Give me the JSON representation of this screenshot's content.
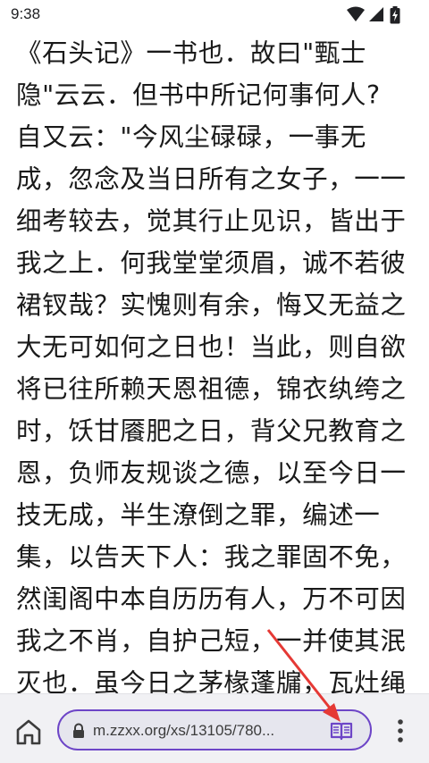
{
  "status_bar": {
    "time": "9:38"
  },
  "content": {
    "lines": [
      "《石头记》一书也．故曰\"甄士",
      "隐\"云云．但书中所记何事何人?",
      "自又云：\"今风尘碌碌，一事无",
      "成，忽念及当日所有之女子，一一",
      "细考较去，觉其行止见识，皆出于",
      "我之上．何我堂堂须眉，诚不若彼",
      "裙钗哉？实愧则有余，悔又无益之",
      "大无可如何之日也！当此，则自欲",
      "将已往所赖天恩祖德，锦衣纨绔之",
      "时，饫甘餍肥之日，背父兄教育之",
      "恩，负师友规谈之德，以至今日一",
      "技无成，半生潦倒之罪，编述一",
      "集，以告天下人：我之罪固不免，",
      "然闺阁中本自历历有人，万不可因",
      "我之不肖，自护己短，一并使其泯",
      "灭也．虽今日之茅椽蓬牖，瓦灶绳"
    ]
  },
  "browser": {
    "url": "m.zzxx.org/xs/13105/780...",
    "icons": {
      "home": "home-icon",
      "lock": "lock-icon",
      "reader": "reader-mode-icon",
      "menu": "more-vert-icon"
    },
    "accent_color": "#6d45c7"
  },
  "annotation": {
    "arrow_color": "#e53935"
  }
}
